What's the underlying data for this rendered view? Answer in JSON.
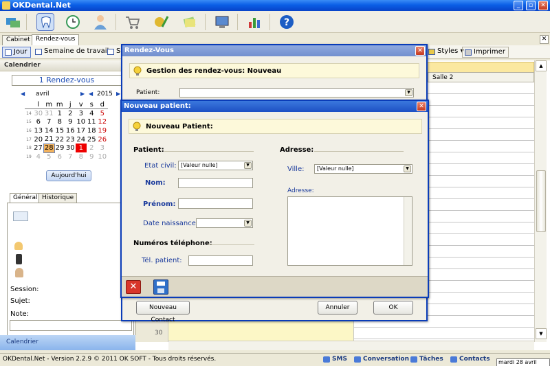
{
  "app": {
    "title": "OKDental.Net"
  },
  "tabs": [
    {
      "label": "Cabinet"
    },
    {
      "label": "Rendez-vous"
    }
  ],
  "views": {
    "jour": "Jour",
    "semaine": "Semaine de travail",
    "s_truncated": "S",
    "styles": "Styles",
    "imprimer": "Imprimer"
  },
  "calendar": {
    "header": "Calendrier",
    "rdv_count": "1 Rendez-vous",
    "month": "avril",
    "year": "2015",
    "weekdays": [
      "l",
      "m",
      "m",
      "j",
      "v",
      "s",
      "d"
    ],
    "weeks": [
      {
        "num": "14",
        "days": [
          "30",
          "31",
          "1",
          "2",
          "3",
          "4",
          "5"
        ]
      },
      {
        "num": "15",
        "days": [
          "6",
          "7",
          "8",
          "9",
          "10",
          "11",
          "12"
        ]
      },
      {
        "num": "16",
        "days": [
          "13",
          "14",
          "15",
          "16",
          "17",
          "18",
          "19"
        ]
      },
      {
        "num": "17",
        "days": [
          "20",
          "21",
          "22",
          "23",
          "24",
          "25",
          "26"
        ]
      },
      {
        "num": "18",
        "days": [
          "27",
          "28",
          "29",
          "30",
          "1",
          "2",
          "3"
        ]
      },
      {
        "num": "19",
        "days": [
          "4",
          "5",
          "6",
          "7",
          "8",
          "9",
          "10"
        ]
      }
    ],
    "today_button": "Aujourd'hui",
    "footer": "Calendrier"
  },
  "left_tabs": {
    "general": "Général",
    "historique": "Historique"
  },
  "left_fields": {
    "session": "Session:",
    "sujet": "Sujet:",
    "note": "Note:"
  },
  "grid": {
    "salle2": "Salle 2",
    "time_label": "30"
  },
  "status": {
    "copyright": "OKDental.Net - Version 2.2.9 © 2011 OK SOFT - Tous droits réservés.",
    "sms": "SMS",
    "conversation": "Conversation",
    "taches": "Tâches",
    "contacts": "Contacts",
    "date": "mardi 28 avril 2015"
  },
  "rdv_dialog": {
    "title": "Rendez-Vous",
    "banner": "Gestion des rendez-vous: Nouveau",
    "patient_label": "Patient:",
    "nouveau_contact": "Nouveau Contact",
    "annuler": "Annuler",
    "ok": "OK"
  },
  "patient_dialog": {
    "title": "Nouveau patient:",
    "banner": "Nouveau Patient:",
    "section_patient": "Patient:",
    "section_adresse": "Adresse:",
    "section_phone": "Numéros téléphone:",
    "etat_civil_label": "Etat civil:",
    "etat_civil_value": "[Valeur nulle]",
    "nom_label": "Nom:",
    "prenom_label": "Prénom:",
    "date_naissance_label": "Date naissance:",
    "tel_label": "Tél. patient:",
    "ville_label": "Ville:",
    "ville_value": "[Valeur nulle]",
    "adresse_label": "Adresse:"
  },
  "colors": {
    "titlebar": "#0a5fe6",
    "dialog_border": "#0a3cb8",
    "accent_red": "#e00000",
    "today": "#f1b25e"
  }
}
